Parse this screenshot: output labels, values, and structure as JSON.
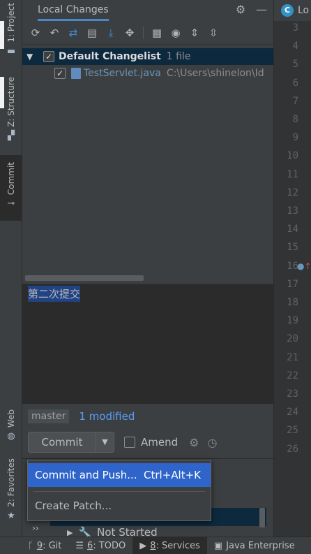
{
  "left_strip": {
    "tabs": [
      {
        "label": "1: Project",
        "icon": "folder-icon"
      },
      {
        "label": "Z: Structure",
        "icon": "structure-icon"
      },
      {
        "label": "Commit",
        "icon": "commit-icon"
      },
      {
        "label": "Web",
        "icon": "globe-icon"
      },
      {
        "label": "2: Favorites",
        "icon": "star-icon"
      }
    ]
  },
  "panel": {
    "title": "Local Changes",
    "header_icons": [
      "gear-icon",
      "minimize-icon"
    ],
    "toolbar_icons": [
      "refresh-icon",
      "rollback-icon",
      "diff-icon",
      "changelist-icon",
      "update-icon",
      "shelve-icon",
      "group-by-icon",
      "preview-icon",
      "expand-all-icon",
      "collapse-all-icon"
    ]
  },
  "tree": {
    "changelist": {
      "name": "Default Changelist",
      "count": "1 file"
    },
    "file": {
      "name": "TestServlet.java",
      "path": "C:\\Users\\shinelon\\Id"
    }
  },
  "commit_message": "第二次提交",
  "status": {
    "branch": "master",
    "modified": "1 modified"
  },
  "actions": {
    "commit_label": "Commit",
    "amend_label": "Amend"
  },
  "popup": {
    "items": [
      {
        "label": "Commit and Push...",
        "shortcut": "Ctrl+Alt+K"
      },
      {
        "label": "Create Patch...",
        "shortcut": ""
      }
    ]
  },
  "services": {
    "collapse_chevron": "››",
    "item": "Not Started"
  },
  "editor": {
    "tab_label": "Lo",
    "tab_icon_letter": "C",
    "line_numbers": [
      "3",
      "4",
      "5",
      "6",
      "7",
      "8",
      "9",
      "10",
      "11",
      "12",
      "13",
      "14",
      "15",
      "16",
      "17",
      "18",
      "19",
      "20",
      "21",
      "22",
      "23",
      "24",
      "25",
      "26"
    ]
  },
  "bottom_bar": {
    "items": [
      {
        "key": "9",
        "label": ": Git",
        "icon": "git-icon"
      },
      {
        "key": "6",
        "label": ": TODO",
        "icon": "todo-icon"
      },
      {
        "key": "8",
        "label": ": Services",
        "icon": "services-icon"
      },
      {
        "key": "",
        "label": "Java Enterprise",
        "icon": "java-enterprise-icon"
      }
    ]
  },
  "colors": {
    "accent": "#4a88c7",
    "selection": "#0d293e",
    "popup_highlight": "#2f65ca",
    "link": "#589df6"
  }
}
